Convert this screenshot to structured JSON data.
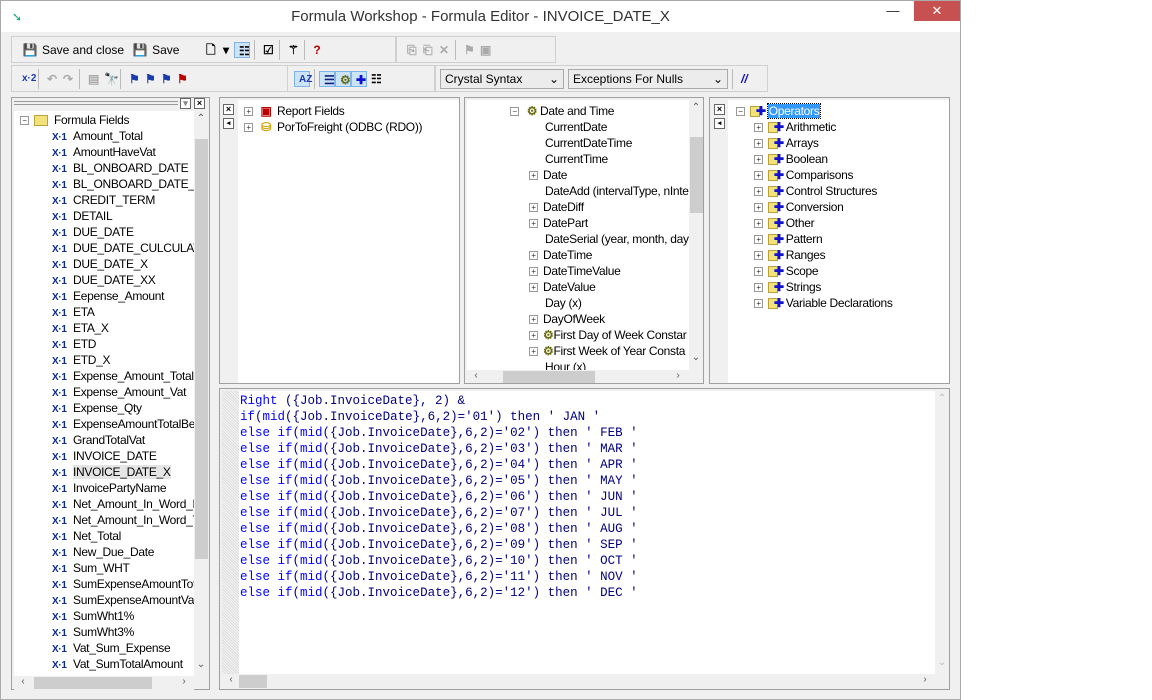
{
  "window": {
    "title": "Formula Workshop - Formula Editor - INVOICE_DATE_X",
    "minimize": "—",
    "maximize": "☐",
    "close": "✕"
  },
  "toolbar1": {
    "save_and_close": "Save and close",
    "save": "Save"
  },
  "toolbar2": {
    "syntax_select": "Crystal Syntax",
    "nulls_select": "Exceptions For Nulls",
    "comment_label": "//"
  },
  "workshop_tree": {
    "root": "Formula Fields",
    "selected": "INVOICE_DATE_X",
    "items": [
      "Amount_Total",
      "AmountHaveVat",
      "BL_ONBOARD_DATE",
      "BL_ONBOARD_DATE_",
      "CREDIT_TERM",
      "DETAIL",
      "DUE_DATE",
      "DUE_DATE_CULCULAT",
      "DUE_DATE_X",
      "DUE_DATE_XX",
      "Eepense_Amount",
      "ETA",
      "ETA_X",
      "ETD",
      "ETD_X",
      "Expense_Amount_Total",
      "Expense_Amount_Vat",
      "Expense_Qty",
      "ExpenseAmountTotalBef",
      "GrandTotalVat",
      "INVOICE_DATE",
      "INVOICE_DATE_X",
      "InvoicePartyName",
      "Net_Amount_In_Word_E",
      "Net_Amount_In_Word_T",
      "Net_Total",
      "New_Due_Date",
      "Sum_WHT",
      "SumExpenseAmountTota",
      "SumExpenseAmountVat",
      "SumWht1%",
      "SumWht3%",
      "Vat_Sum_Expense",
      "Vat_SumTotalAmount"
    ]
  },
  "fields_tree": {
    "items": [
      "Report Fields",
      "PorToFreight (ODBC (RDO))"
    ]
  },
  "functions_tree": {
    "root": "Date and Time",
    "items": [
      {
        "label": "CurrentDate",
        "expand": false
      },
      {
        "label": "CurrentDateTime",
        "expand": false
      },
      {
        "label": "CurrentTime",
        "expand": false
      },
      {
        "label": "Date",
        "expand": true
      },
      {
        "label": "DateAdd (intervalType, nInter",
        "expand": false
      },
      {
        "label": "DateDiff",
        "expand": true
      },
      {
        "label": "DatePart",
        "expand": true
      },
      {
        "label": "DateSerial (year, month, day)",
        "expand": false
      },
      {
        "label": "DateTime",
        "expand": true
      },
      {
        "label": "DateTimeValue",
        "expand": true
      },
      {
        "label": "DateValue",
        "expand": true
      },
      {
        "label": "Day (x)",
        "expand": false
      },
      {
        "label": "DayOfWeek",
        "expand": true
      },
      {
        "label": "First Day of Week Constar",
        "expand": true,
        "folder": true
      },
      {
        "label": "First Week of Year Consta",
        "expand": true,
        "folder": true
      },
      {
        "label": "Hour (x)",
        "expand": false
      }
    ]
  },
  "operators_tree": {
    "root": "Operators",
    "items": [
      "Arithmetic",
      "Arrays",
      "Boolean",
      "Comparisons",
      "Control Structures",
      "Conversion",
      "Other",
      "Pattern",
      "Ranges",
      "Scope",
      "Strings",
      "Variable Declarations"
    ]
  },
  "editor": {
    "lines": [
      [
        {
          "k": "Right"
        },
        {
          "t": " ({Job.InvoiceDate}, 2) &"
        }
      ],
      [
        {
          "k": "if"
        },
        {
          "t": "("
        },
        {
          "k": "mid"
        },
        {
          "t": "({Job.InvoiceDate},6,2)='01') then ' JAN '"
        }
      ],
      [
        {
          "k": "else if"
        },
        {
          "t": "("
        },
        {
          "k": "mid"
        },
        {
          "t": "({Job.InvoiceDate},6,2)='02') then ' FEB '"
        }
      ],
      [
        {
          "k": "else if"
        },
        {
          "t": "("
        },
        {
          "k": "mid"
        },
        {
          "t": "({Job.InvoiceDate},6,2)='03') then ' MAR '"
        }
      ],
      [
        {
          "k": "else if"
        },
        {
          "t": "("
        },
        {
          "k": "mid"
        },
        {
          "t": "({Job.InvoiceDate},6,2)='04') then ' APR '"
        }
      ],
      [
        {
          "k": "else if"
        },
        {
          "t": "("
        },
        {
          "k": "mid"
        },
        {
          "t": "({Job.InvoiceDate},6,2)='05') then ' MAY '"
        }
      ],
      [
        {
          "k": "else if"
        },
        {
          "t": "("
        },
        {
          "k": "mid"
        },
        {
          "t": "({Job.InvoiceDate},6,2)='06') then ' JUN '"
        }
      ],
      [
        {
          "k": "else if"
        },
        {
          "t": "("
        },
        {
          "k": "mid"
        },
        {
          "t": "({Job.InvoiceDate},6,2)='07') then ' JUL '"
        }
      ],
      [
        {
          "k": "else if"
        },
        {
          "t": "("
        },
        {
          "k": "mid"
        },
        {
          "t": "({Job.InvoiceDate},6,2)='08') then ' AUG '"
        }
      ],
      [
        {
          "k": "else if"
        },
        {
          "t": "("
        },
        {
          "k": "mid"
        },
        {
          "t": "({Job.InvoiceDate},6,2)='09') then ' SEP '"
        }
      ],
      [
        {
          "k": "else if"
        },
        {
          "t": "("
        },
        {
          "k": "mid"
        },
        {
          "t": "({Job.InvoiceDate},6,2)='10') then ' OCT '"
        }
      ],
      [
        {
          "k": "else if"
        },
        {
          "t": "("
        },
        {
          "k": "mid"
        },
        {
          "t": "({Job.InvoiceDate},6,2)='11') then ' NOV '"
        }
      ],
      [
        {
          "k": "else if"
        },
        {
          "t": "("
        },
        {
          "k": "mid"
        },
        {
          "t": "({Job.InvoiceDate},6,2)='12') then ' DEC '"
        }
      ]
    ]
  },
  "colors": {
    "keyword": "#0000ff",
    "text": "#000080",
    "close_button": "#c75050",
    "selection": "#3399ff"
  }
}
